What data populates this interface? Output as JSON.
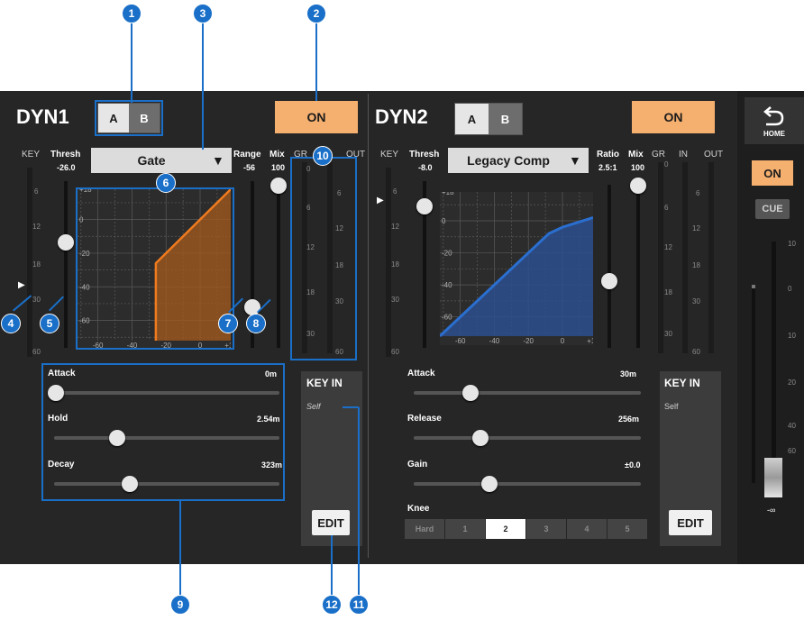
{
  "dyn1": {
    "title": "DYN1",
    "seg_a": "A",
    "seg_b": "B",
    "on_label": "ON",
    "key_label": "KEY",
    "thresh_label": "Thresh",
    "thresh_value": "-26.0",
    "type_label": "Gate",
    "range_label": "Range",
    "range_value": "-56",
    "mix_label": "Mix",
    "mix_value": "100",
    "gr_label": "GR",
    "out_label": "OUT",
    "key_scale": [
      "6",
      "12",
      "18",
      "30",
      "60"
    ],
    "graph_y_ticks": [
      "+18",
      "0",
      "-20",
      "-40",
      "-60"
    ],
    "graph_x_ticks": [
      "-60",
      "-40",
      "-20",
      "0",
      "+18"
    ],
    "gr_scale": [
      "0",
      "6",
      "12",
      "18",
      "30"
    ],
    "out_scale": [
      "6",
      "12",
      "18",
      "30",
      "60"
    ],
    "params": [
      {
        "label": "Attack",
        "value": "0m",
        "level": 0.0
      },
      {
        "label": "Hold",
        "value": "2.54m",
        "level": 0.28
      },
      {
        "label": "Decay",
        "value": "323m",
        "level": 0.33
      }
    ],
    "keyin_title": "KEY IN",
    "keyin_source": "Self",
    "edit_label": "EDIT"
  },
  "dyn2": {
    "title": "DYN2",
    "seg_a": "A",
    "seg_b": "B",
    "on_label": "ON",
    "key_label": "KEY",
    "thresh_label": "Thresh",
    "thresh_value": "-8.0",
    "type_label": "Legacy Comp",
    "ratio_label": "Ratio",
    "ratio_value": "2.5:1",
    "mix_label": "Mix",
    "mix_value": "100",
    "gr_label": "GR",
    "in_label": "IN",
    "out_label": "OUT",
    "key_scale": [
      "6",
      "12",
      "18",
      "30",
      "60"
    ],
    "graph_y_ticks": [
      "+18",
      "0",
      "-20",
      "-40",
      "-60"
    ],
    "graph_x_ticks": [
      "-60",
      "-40",
      "-20",
      "0",
      "+18"
    ],
    "gr_scale": [
      "0",
      "6",
      "12",
      "18",
      "30"
    ],
    "out_scale": [
      "6",
      "12",
      "18",
      "30",
      "60"
    ],
    "params": [
      {
        "label": "Attack",
        "value": "30m",
        "level": 0.25
      },
      {
        "label": "Release",
        "value": "256m",
        "level": 0.29
      },
      {
        "label": "Gain",
        "value": "±0.0",
        "level": 0.33
      }
    ],
    "knee_label": "Knee",
    "knee_options": [
      "Hard",
      "1",
      "2",
      "3",
      "4",
      "5"
    ],
    "knee_selected": "2",
    "keyin_title": "KEY IN",
    "keyin_source": "Self",
    "edit_label": "EDIT"
  },
  "sidebar": {
    "home_label": "HOME",
    "on_label": "ON",
    "cue_label": "CUE",
    "fader_scale": [
      "10",
      "0",
      "10",
      "20",
      "40",
      "60"
    ],
    "fader_value": "-∞"
  },
  "callouts": [
    "1",
    "2",
    "3",
    "4",
    "5",
    "6",
    "7",
    "8",
    "9",
    "10",
    "11",
    "12"
  ],
  "colors": {
    "accent_on": "#f5b070",
    "gate_curve": "#f07b1e",
    "comp_curve": "#2a6fd0",
    "callout": "#1a6fc8"
  },
  "chart_data": [
    {
      "type": "line",
      "title": "Gate",
      "xlim": [
        -72,
        18
      ],
      "ylim": [
        -72,
        18
      ],
      "x_ticks": [
        "-60",
        "-40",
        "-20",
        "0",
        "+18"
      ],
      "y_ticks": [
        "+18",
        "0",
        "-20",
        "-40",
        "-60"
      ],
      "series": [
        {
          "x": [
            -26,
            -26,
            18
          ],
          "y": [
            -72,
            -26,
            18
          ]
        }
      ]
    },
    {
      "type": "line",
      "title": "Legacy Comp",
      "xlim": [
        -72,
        18
      ],
      "ylim": [
        -72,
        18
      ],
      "x_ticks": [
        "-60",
        "-40",
        "-20",
        "0",
        "+18"
      ],
      "y_ticks": [
        "+18",
        "0",
        "-20",
        "-40",
        "-60"
      ],
      "series": [
        {
          "x": [
            -72,
            -15,
            -8,
            0,
            18
          ],
          "y": [
            -72,
            -15,
            -8,
            -4,
            2
          ]
        }
      ]
    }
  ]
}
